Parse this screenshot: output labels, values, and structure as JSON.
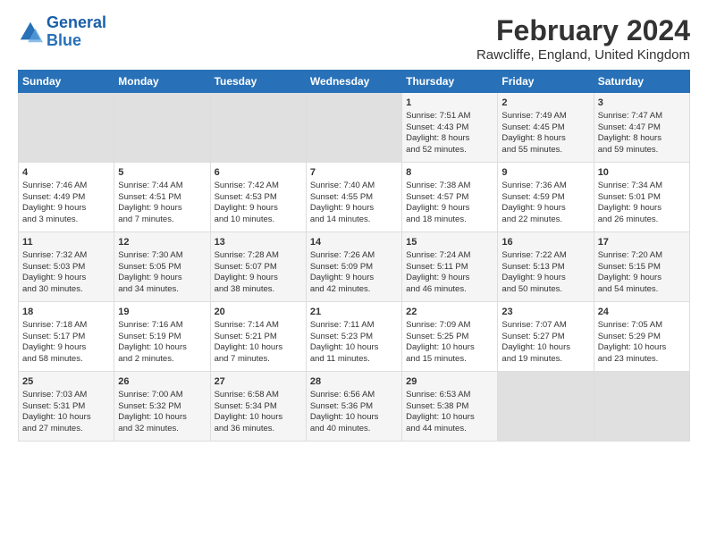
{
  "logo": {
    "line1": "General",
    "line2": "Blue"
  },
  "title": "February 2024",
  "subtitle": "Rawcliffe, England, United Kingdom",
  "days_header": [
    "Sunday",
    "Monday",
    "Tuesday",
    "Wednesday",
    "Thursday",
    "Friday",
    "Saturday"
  ],
  "weeks": [
    {
      "cells": [
        {
          "empty": true
        },
        {
          "empty": true
        },
        {
          "empty": true
        },
        {
          "empty": true
        },
        {
          "day": 1,
          "sunrise": "7:51 AM",
          "sunset": "4:43 PM",
          "daylight": "8 hours and 52 minutes."
        },
        {
          "day": 2,
          "sunrise": "7:49 AM",
          "sunset": "4:45 PM",
          "daylight": "8 hours and 55 minutes."
        },
        {
          "day": 3,
          "sunrise": "7:47 AM",
          "sunset": "4:47 PM",
          "daylight": "8 hours and 59 minutes."
        }
      ]
    },
    {
      "cells": [
        {
          "day": 4,
          "sunrise": "7:46 AM",
          "sunset": "4:49 PM",
          "daylight": "9 hours and 3 minutes."
        },
        {
          "day": 5,
          "sunrise": "7:44 AM",
          "sunset": "4:51 PM",
          "daylight": "9 hours and 7 minutes."
        },
        {
          "day": 6,
          "sunrise": "7:42 AM",
          "sunset": "4:53 PM",
          "daylight": "9 hours and 10 minutes."
        },
        {
          "day": 7,
          "sunrise": "7:40 AM",
          "sunset": "4:55 PM",
          "daylight": "9 hours and 14 minutes."
        },
        {
          "day": 8,
          "sunrise": "7:38 AM",
          "sunset": "4:57 PM",
          "daylight": "9 hours and 18 minutes."
        },
        {
          "day": 9,
          "sunrise": "7:36 AM",
          "sunset": "4:59 PM",
          "daylight": "9 hours and 22 minutes."
        },
        {
          "day": 10,
          "sunrise": "7:34 AM",
          "sunset": "5:01 PM",
          "daylight": "9 hours and 26 minutes."
        }
      ]
    },
    {
      "cells": [
        {
          "day": 11,
          "sunrise": "7:32 AM",
          "sunset": "5:03 PM",
          "daylight": "9 hours and 30 minutes."
        },
        {
          "day": 12,
          "sunrise": "7:30 AM",
          "sunset": "5:05 PM",
          "daylight": "9 hours and 34 minutes."
        },
        {
          "day": 13,
          "sunrise": "7:28 AM",
          "sunset": "5:07 PM",
          "daylight": "9 hours and 38 minutes."
        },
        {
          "day": 14,
          "sunrise": "7:26 AM",
          "sunset": "5:09 PM",
          "daylight": "9 hours and 42 minutes."
        },
        {
          "day": 15,
          "sunrise": "7:24 AM",
          "sunset": "5:11 PM",
          "daylight": "9 hours and 46 minutes."
        },
        {
          "day": 16,
          "sunrise": "7:22 AM",
          "sunset": "5:13 PM",
          "daylight": "9 hours and 50 minutes."
        },
        {
          "day": 17,
          "sunrise": "7:20 AM",
          "sunset": "5:15 PM",
          "daylight": "9 hours and 54 minutes."
        }
      ]
    },
    {
      "cells": [
        {
          "day": 18,
          "sunrise": "7:18 AM",
          "sunset": "5:17 PM",
          "daylight": "9 hours and 58 minutes."
        },
        {
          "day": 19,
          "sunrise": "7:16 AM",
          "sunset": "5:19 PM",
          "daylight": "10 hours and 2 minutes."
        },
        {
          "day": 20,
          "sunrise": "7:14 AM",
          "sunset": "5:21 PM",
          "daylight": "10 hours and 7 minutes."
        },
        {
          "day": 21,
          "sunrise": "7:11 AM",
          "sunset": "5:23 PM",
          "daylight": "10 hours and 11 minutes."
        },
        {
          "day": 22,
          "sunrise": "7:09 AM",
          "sunset": "5:25 PM",
          "daylight": "10 hours and 15 minutes."
        },
        {
          "day": 23,
          "sunrise": "7:07 AM",
          "sunset": "5:27 PM",
          "daylight": "10 hours and 19 minutes."
        },
        {
          "day": 24,
          "sunrise": "7:05 AM",
          "sunset": "5:29 PM",
          "daylight": "10 hours and 23 minutes."
        }
      ]
    },
    {
      "cells": [
        {
          "day": 25,
          "sunrise": "7:03 AM",
          "sunset": "5:31 PM",
          "daylight": "10 hours and 27 minutes."
        },
        {
          "day": 26,
          "sunrise": "7:00 AM",
          "sunset": "5:32 PM",
          "daylight": "10 hours and 32 minutes."
        },
        {
          "day": 27,
          "sunrise": "6:58 AM",
          "sunset": "5:34 PM",
          "daylight": "10 hours and 36 minutes."
        },
        {
          "day": 28,
          "sunrise": "6:56 AM",
          "sunset": "5:36 PM",
          "daylight": "10 hours and 40 minutes."
        },
        {
          "day": 29,
          "sunrise": "6:53 AM",
          "sunset": "5:38 PM",
          "daylight": "10 hours and 44 minutes."
        },
        {
          "empty": true
        },
        {
          "empty": true
        }
      ]
    }
  ]
}
